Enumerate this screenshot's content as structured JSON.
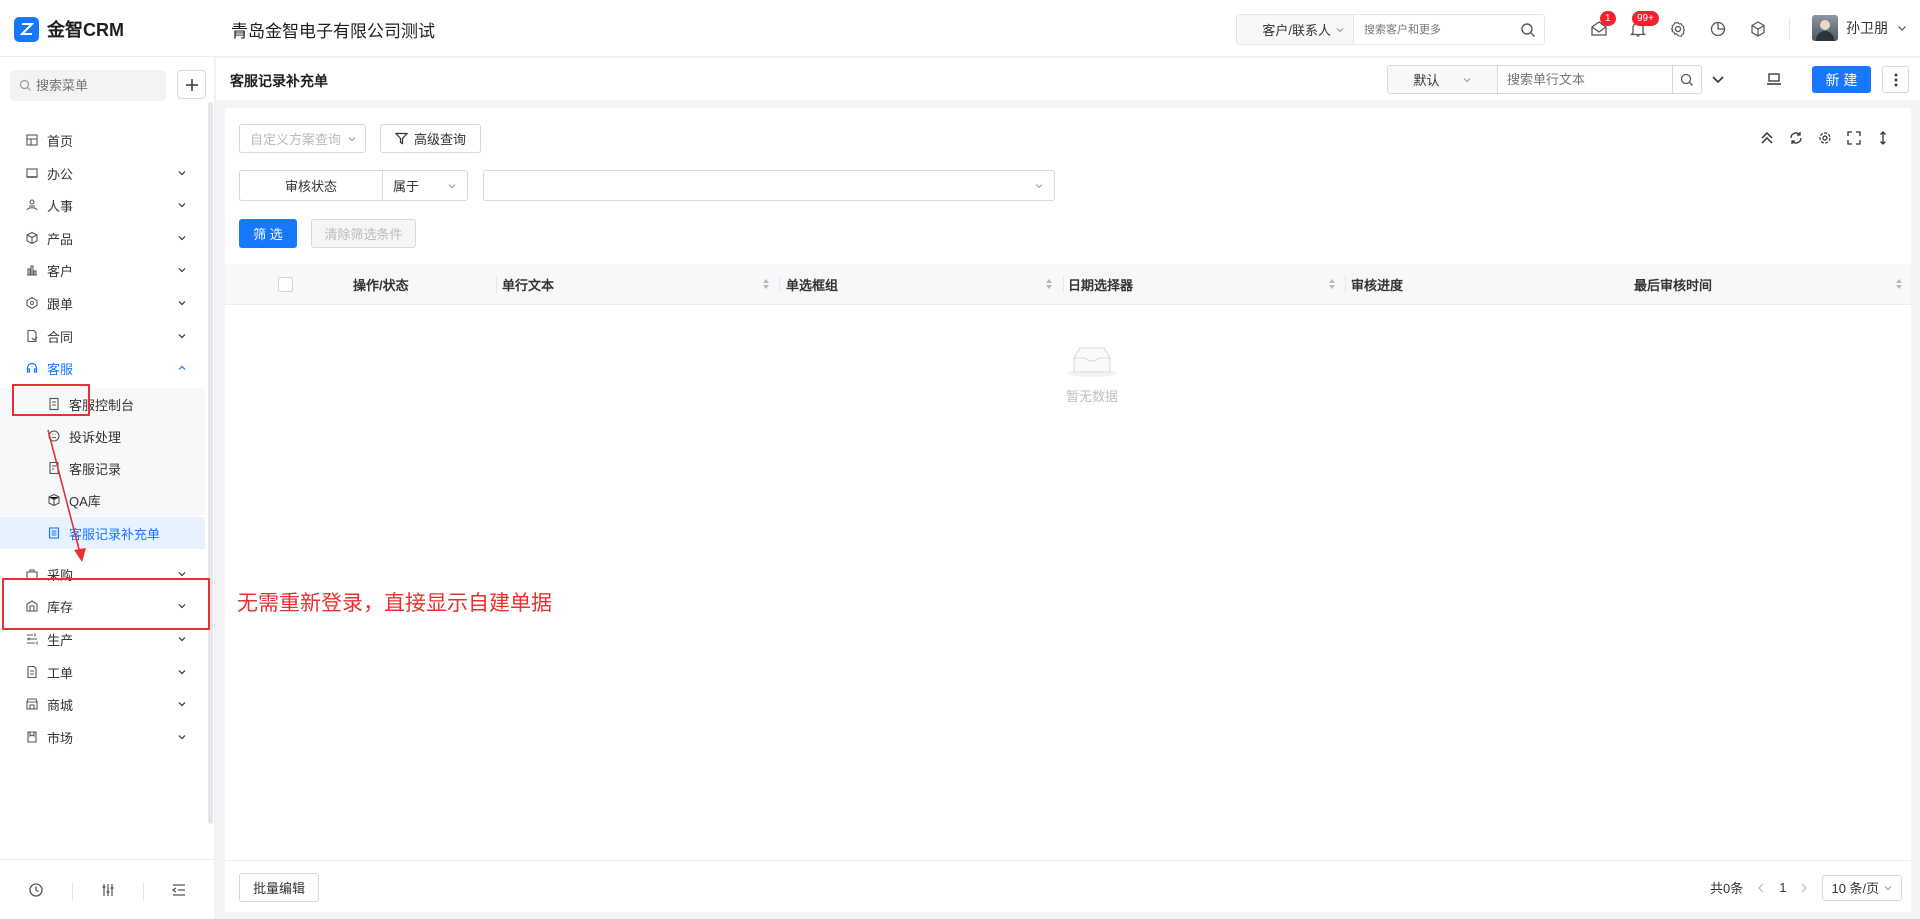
{
  "header": {
    "logo_text": "金智CRM",
    "company": "青岛金智电子有限公司测试",
    "search_type": "客户/联系人",
    "search_placeholder": "搜索客户和更多",
    "message_count": "1",
    "notify_count": "99+",
    "user_name": "孙卫朋"
  },
  "sidebar": {
    "search_placeholder": "搜索菜单",
    "items": [
      {
        "label": "首页",
        "icon": "home-icon"
      },
      {
        "label": "办公",
        "icon": "office-icon"
      },
      {
        "label": "人事",
        "icon": "hr-icon"
      },
      {
        "label": "产品",
        "icon": "product-icon"
      },
      {
        "label": "客户",
        "icon": "customer-icon"
      },
      {
        "label": "跟单",
        "icon": "followup-icon"
      },
      {
        "label": "合同",
        "icon": "contract-icon"
      },
      {
        "label": "客服",
        "icon": "headset-icon"
      }
    ],
    "sub_items": [
      {
        "label": "客服控制台",
        "icon": "console-icon"
      },
      {
        "label": "投诉处理",
        "icon": "complaint-icon"
      },
      {
        "label": "客服记录",
        "icon": "record-icon"
      },
      {
        "label": "QA库",
        "icon": "qa-icon"
      },
      {
        "label": "客服记录补充单",
        "icon": "form-icon"
      }
    ],
    "items_after": [
      {
        "label": "采购",
        "icon": "purchase-icon"
      },
      {
        "label": "库存",
        "icon": "inventory-icon"
      },
      {
        "label": "生产",
        "icon": "production-icon"
      },
      {
        "label": "工单",
        "icon": "workorder-icon"
      },
      {
        "label": "商城",
        "icon": "mall-icon"
      },
      {
        "label": "市场",
        "icon": "market-icon"
      }
    ]
  },
  "toolbar": {
    "page_title": "客服记录补充单",
    "view_select": "默认",
    "search_placeholder": "搜索单行文本",
    "new_label": "新 建"
  },
  "filter": {
    "scheme_placeholder": "自定义方案查询",
    "advanced_label": "高级查询",
    "field": "审核状态",
    "operator": "属于",
    "filter_label": "筛 选",
    "clear_label": "清除筛选条件"
  },
  "table": {
    "columns": [
      "操作/状态",
      "单行文本",
      "单选框组",
      "日期选择器",
      "审核进度",
      "最后审核时间"
    ],
    "empty_text": "暂无数据"
  },
  "footer": {
    "batch_label": "批量编辑",
    "total": "共0条",
    "current_page": "1",
    "page_size": "10 条/页"
  },
  "annotation": {
    "text": "无需重新登录，直接显示自建单据",
    "color": "#e5312f"
  },
  "colors": {
    "accent": "#1677ff",
    "badge": "#f5222d"
  }
}
